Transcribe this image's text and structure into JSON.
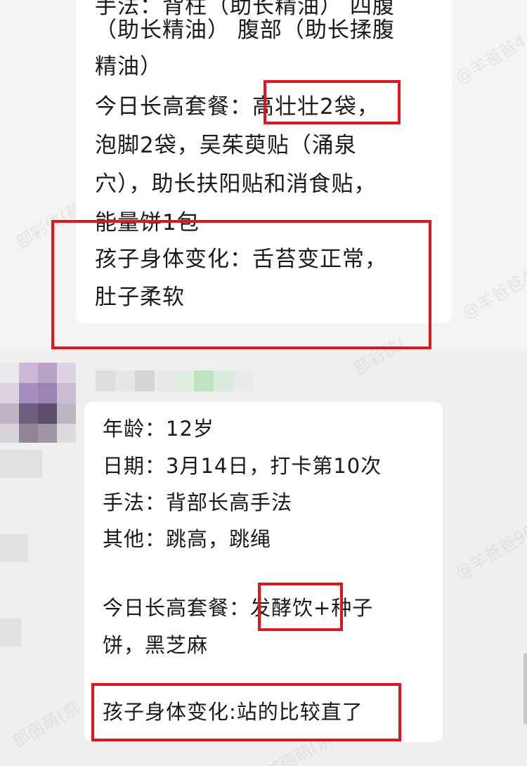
{
  "top_message": {
    "lines": [
      "手法：背柱（助长精油）  四腹",
      "（助长精油） 腹部（助长揉腹",
      "精油）",
      "今日长高套餐：高壮壮2袋，",
      "泡脚2袋，吴茱萸贴（涌泉",
      "穴），助长扶阳贴和消食贴，",
      "能量饼1包",
      "孩子身体变化：舌苔变正常，",
      "肚子柔软"
    ]
  },
  "bottom_message": {
    "age": "年龄：12岁",
    "date": "日期：3月14日，打卡第10次",
    "method": "手法：背部长高手法",
    "other": "其他：跳高，跳绳",
    "package_line1": "今日长高套餐：发酵饮+种子",
    "package_line2": "饼，黑芝麻",
    "change": "孩子身体变化:站的比较直了"
  },
  "watermarks": [
    "@羊爸爸4",
    "@羊爸爸4",
    "部彩侠(",
    "部彩侠(蔓",
    "@羊爸爸99",
    "部丽萌(京",
    "部丽萌(京"
  ],
  "colors": {
    "highlight_border": "#e0161e",
    "bubble_bg": "#ffffff",
    "text": "#1a1a1a"
  }
}
